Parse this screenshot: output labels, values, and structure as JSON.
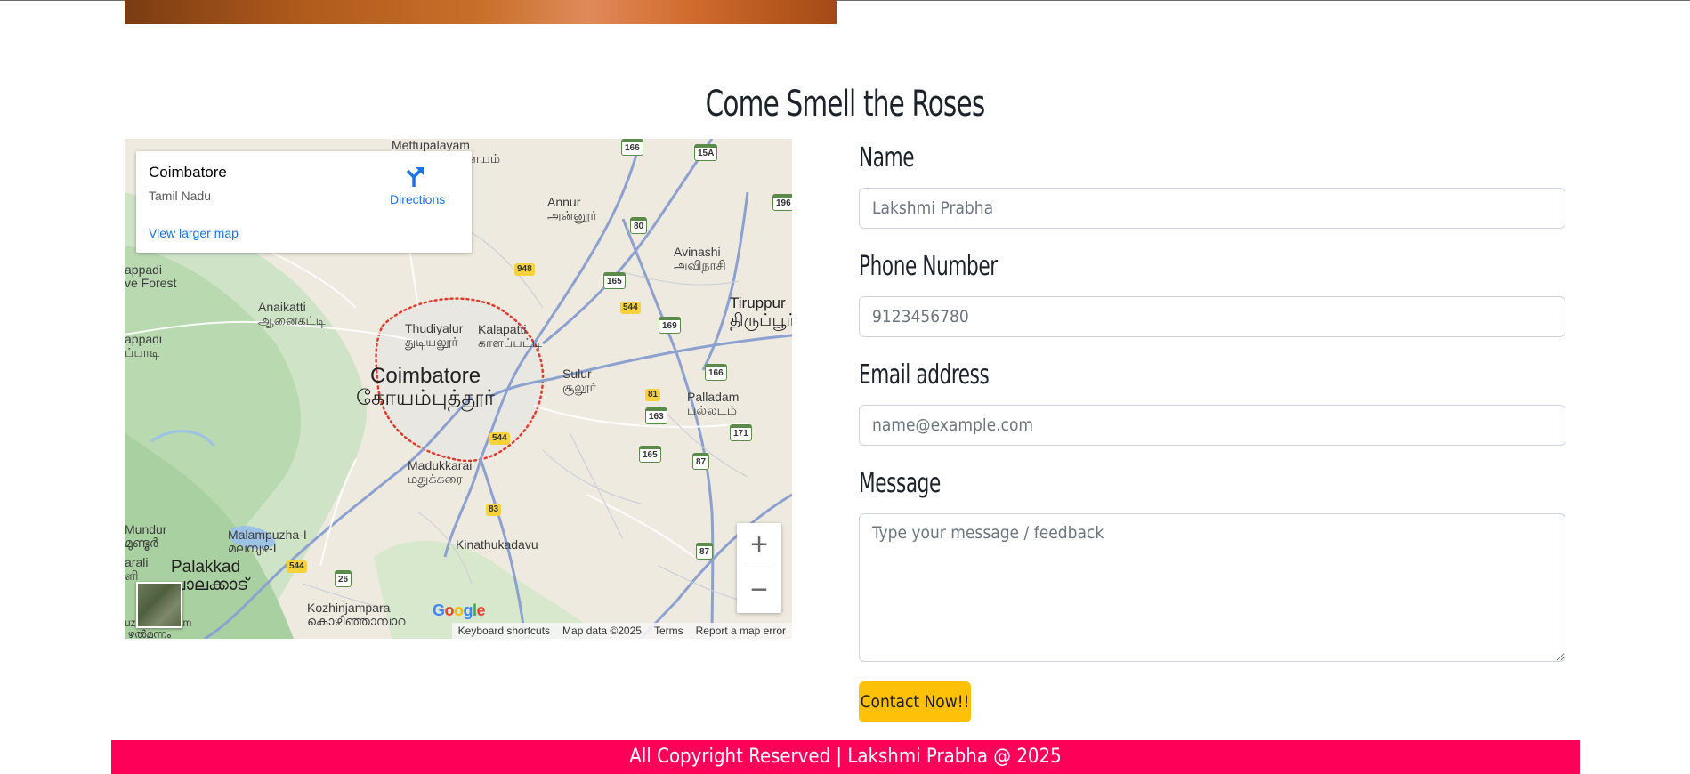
{
  "section": {
    "heading": "Come Smell the Roses"
  },
  "map": {
    "card": {
      "place_name": "Coimbatore",
      "region": "Tamil Nadu",
      "directions_label": "Directions",
      "larger_map_label": "View larger map"
    },
    "labels": {
      "mettupalayam": "Mettupalayam",
      "mettupalayam_ta": "மேட்டுப்பாளையம்",
      "annur": "Annur",
      "annur_ta": "அன்னூர்",
      "avinashi": "Avinashi",
      "avinashi_ta": "அவிநாசி",
      "tiruppur": "Tiruppur",
      "tiruppur_ta": "திருப்பூர்",
      "anaikatti": "Anaikatti",
      "anaikatti_ta": "ஆனைகட்டி",
      "thudiyalur": "Thudiyalur",
      "thudiyalur_ta": "துடியலூர்",
      "kalapatti": "Kalapatti",
      "kalapatti_ta": "காளப்பட்டி",
      "coimbatore": "Coimbatore",
      "coimbatore_ta": "கோயம்புத்தூர்",
      "sulur": "Sulur",
      "sulur_ta": "சூலூர்",
      "palladam": "Palladam",
      "palladam_ta": "பல்லடம்",
      "madukkarai": "Madukkarai",
      "madukkarai_ta": "மதுக்கரை",
      "malampuzha": "Malampuzha-I",
      "malampuzha_ml": "മലമ്പുഴ-I",
      "kinathukadavu": "Kinathukadavu",
      "kinathukadavu_ta": "கிணத்துக்கடவு",
      "mundur": "Mundur",
      "mundur_ml": "മുണ്ടൂർ",
      "palakkad": "Palakkad",
      "palakkad_ml": "പാലക്കാട്",
      "kozhinjampara": "Kozhinjampara",
      "kozhinjampara_ml": "കൊഴിഞ്ഞാമ്പാറ",
      "forest": "appadi\nve Forest",
      "appadi": "appadi\nப்பாடி",
      "arali": "arali\nளி",
      "edge_south": "uzhalmannam\n ഴൽമന്നം"
    },
    "shields": {
      "r166": "166",
      "r15a": "15A",
      "r196": "196",
      "r80": "80",
      "r948": "948",
      "r165": "165",
      "r544a": "544",
      "r169": "169",
      "r166b": "166",
      "r81": "81",
      "r544b": "544",
      "r163": "163",
      "r171": "171",
      "r165b": "165",
      "r87": "87",
      "r83": "83",
      "r87b": "87",
      "r544c": "544",
      "r26": "26"
    },
    "zoom_in_label": "+",
    "zoom_out_label": "−",
    "google_letters": [
      "G",
      "o",
      "o",
      "g",
      "l",
      "e"
    ],
    "attribution": {
      "shortcuts": "Keyboard shortcuts",
      "map_data": "Map data ©2025",
      "terms": "Terms",
      "report": "Report a map error"
    }
  },
  "form": {
    "name": {
      "label": "Name",
      "placeholder": "Lakshmi Prabha"
    },
    "phone": {
      "label": "Phone Number",
      "placeholder": "9123456780"
    },
    "email": {
      "label": "Email address",
      "placeholder": "name@example.com"
    },
    "message": {
      "label": "Message",
      "placeholder": "Type your message / feedback"
    },
    "submit_label": "Contact Now!!"
  },
  "footer": {
    "text": "All Copyright Reserved | Lakshmi Prabha @ 2025"
  },
  "colors": {
    "footer_bg": "#ff0059",
    "button_bg": "#ffc107",
    "link_blue": "#1a73e8"
  }
}
